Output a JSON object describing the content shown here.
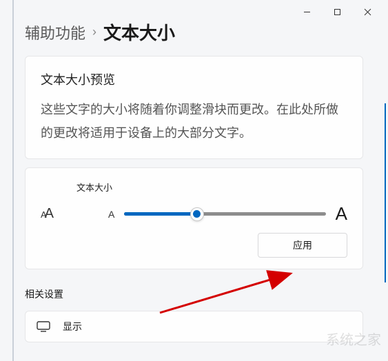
{
  "titlebar": {
    "minimize": "minimize",
    "maximize": "maximize",
    "close": "close"
  },
  "breadcrumb": {
    "parent": "辅助功能",
    "separator": "›",
    "current": "文本大小"
  },
  "preview": {
    "title": "文本大小预览",
    "body": "这些文字的大小将随着你调整滑块而更改。在此处所做的更改将适用于设备上的大部分文字。"
  },
  "slider": {
    "label": "文本大小",
    "min_marker": "A",
    "max_marker": "A",
    "value_percent": 36,
    "apply_button": "应用"
  },
  "related": {
    "section_title": "相关设置",
    "display_label": "显示"
  },
  "watermark_text": "系统之家"
}
